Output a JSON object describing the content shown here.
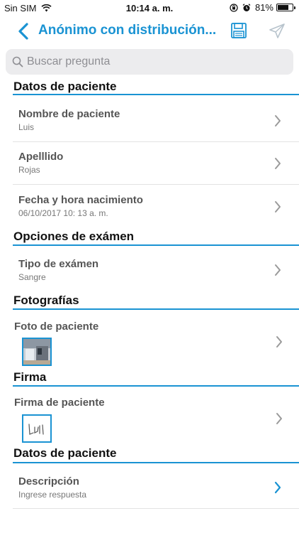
{
  "status_bar": {
    "carrier": "Sin SIM",
    "time": "10:14 a. m.",
    "battery": "81%",
    "battery_level": 0.81
  },
  "nav": {
    "title": "Anónimo con distribución..."
  },
  "search": {
    "placeholder": "Buscar pregunta"
  },
  "sections": [
    {
      "title": "Datos de paciente",
      "rows": [
        {
          "label": "Nombre de paciente",
          "value": "Luis"
        },
        {
          "label": "Apelllido",
          "value": "Rojas"
        },
        {
          "label": "Fecha y hora nacimiento",
          "value": "06/10/2017 10: 13 a. m."
        }
      ]
    },
    {
      "title": "Opciones de exámen",
      "rows": [
        {
          "label": "Tipo de exámen",
          "value": "Sangre"
        }
      ]
    },
    {
      "title": "Fotografías",
      "rows": [
        {
          "label": "Foto de paciente"
        }
      ]
    },
    {
      "title": "Firma",
      "rows": [
        {
          "label": "Firma de paciente"
        }
      ]
    },
    {
      "title": "Datos de paciente",
      "rows": [
        {
          "label": "Descripción",
          "value": "Ingrese respuesta"
        }
      ]
    }
  ],
  "colors": {
    "accent": "#1a93d3",
    "chevron_gray": "#9a9a9a",
    "search_bg": "#ececee"
  },
  "icons": {
    "back": "chevron-left-icon",
    "save": "floppy-disk-icon",
    "send": "paper-plane-icon",
    "search": "magnifier-icon",
    "row": "chevron-right-icon"
  }
}
